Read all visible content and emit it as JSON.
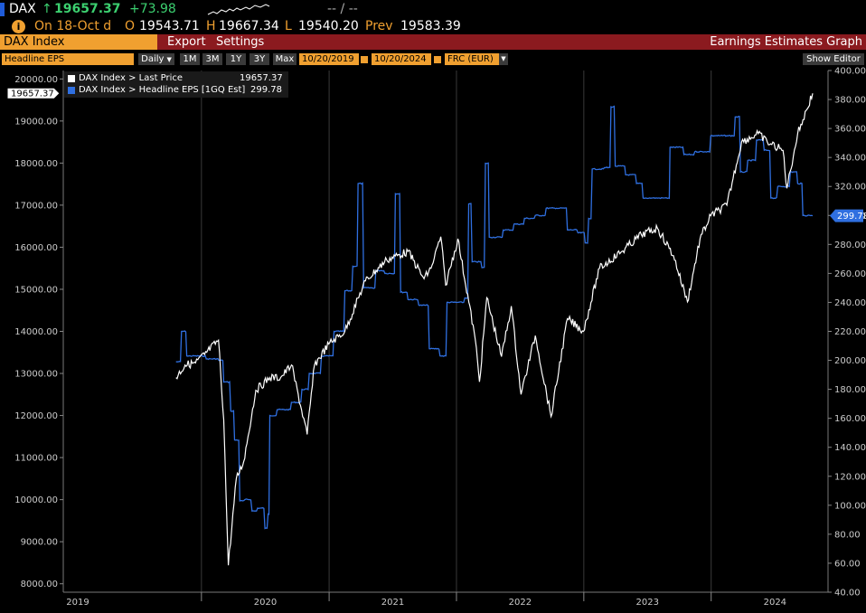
{
  "header": {
    "ticker": "DAX",
    "arrow": "↑",
    "last": "19657.37",
    "change": "+73.98",
    "dashes": "-- / --",
    "date_label": "On 18-Oct d",
    "open_label": "O",
    "open_value": "19543.71",
    "high_label": "H",
    "high_value": "19667.34",
    "low_label": "L",
    "low_value": "19540.20",
    "prev_label": "Prev",
    "prev_value": "19583.39"
  },
  "toolbar": {
    "security": "DAX Index",
    "export_label": "Export",
    "settings_label": "Settings",
    "function_title": "Earnings Estimates Graph"
  },
  "controls": {
    "field": "Headline EPS",
    "period": "Daily",
    "ranges": [
      "1M",
      "3M",
      "1Y",
      "3Y",
      "Max"
    ],
    "start_date": "10/20/2019",
    "end_date": "10/20/2024",
    "currency": "FRC (EUR)",
    "show_editor": "Show Editor"
  },
  "legend": [
    {
      "label": "DAX Index > Last Price",
      "value": "19657.37",
      "color": "#ffffff"
    },
    {
      "label": "DAX Index > Headline EPS [1GQ Est]",
      "value": "299.78",
      "color": "#2f6fe0"
    }
  ],
  "colors": {
    "accent_orange": "#f0a030",
    "toolbar_red": "#8b1a1f",
    "price_line": "#ffffff",
    "eps_line": "#2f6fe0"
  },
  "chart_data": {
    "type": "line",
    "x_labels": [
      "2019",
      "2020",
      "2021",
      "2022",
      "2023",
      "2024"
    ],
    "y_left": {
      "ticks": [
        "8000.00",
        "9000.00",
        "10000.00",
        "11000.00",
        "12000.00",
        "13000.00",
        "14000.00",
        "15000.00",
        "16000.00",
        "17000.00",
        "18000.00",
        "19000.00",
        "20000.00"
      ],
      "range": [
        7800,
        20200
      ]
    },
    "y_right": {
      "ticks": [
        "40.00",
        "60.00",
        "80.00",
        "100.00",
        "120.00",
        "140.00",
        "160.00",
        "180.00",
        "200.00",
        "220.00",
        "240.00",
        "260.00",
        "280.00",
        "300.00",
        "320.00",
        "340.00",
        "360.00",
        "380.00",
        "400.00"
      ],
      "range": [
        40,
        400
      ]
    },
    "last_price_tag": "19657.37",
    "eps_tag": "299.78",
    "series": [
      {
        "name": "DAX Index > Last Price",
        "axis": "left",
        "points": [
          [
            "2019-10-20",
            12900
          ],
          [
            "2019-11-15",
            13200
          ],
          [
            "2019-12-15",
            13250
          ],
          [
            "2020-01-10",
            13450
          ],
          [
            "2020-02-19",
            13790
          ],
          [
            "2020-03-05",
            11900
          ],
          [
            "2020-03-18",
            8440
          ],
          [
            "2020-04-10",
            10500
          ],
          [
            "2020-05-01",
            10900
          ],
          [
            "2020-06-05",
            12600
          ],
          [
            "2020-07-15",
            12900
          ],
          [
            "2020-08-15",
            12900
          ],
          [
            "2020-09-15",
            13200
          ],
          [
            "2020-10-30",
            11550
          ],
          [
            "2020-11-20",
            13200
          ],
          [
            "2020-12-31",
            13700
          ],
          [
            "2021-02-15",
            14000
          ],
          [
            "2021-04-15",
            15200
          ],
          [
            "2021-06-15",
            15700
          ],
          [
            "2021-08-15",
            15900
          ],
          [
            "2021-09-30",
            15250
          ],
          [
            "2021-10-20",
            15500
          ],
          [
            "2021-11-17",
            16250
          ],
          [
            "2021-12-01",
            15100
          ],
          [
            "2022-01-05",
            16200
          ],
          [
            "2022-02-24",
            13800
          ],
          [
            "2022-03-08",
            12800
          ],
          [
            "2022-03-29",
            14800
          ],
          [
            "2022-05-10",
            13400
          ],
          [
            "2022-06-07",
            14600
          ],
          [
            "2022-07-05",
            12500
          ],
          [
            "2022-08-15",
            13900
          ],
          [
            "2022-09-29",
            11975
          ],
          [
            "2022-11-15",
            14300
          ],
          [
            "2022-12-31",
            14000
          ],
          [
            "2023-02-15",
            15500
          ],
          [
            "2023-04-20",
            15900
          ],
          [
            "2023-06-15",
            16300
          ],
          [
            "2023-07-31",
            16450
          ],
          [
            "2023-09-15",
            15800
          ],
          [
            "2023-10-25",
            14700
          ],
          [
            "2023-11-30",
            16200
          ],
          [
            "2023-12-31",
            16750
          ],
          [
            "2024-02-15",
            17000
          ],
          [
            "2024-03-28",
            18500
          ],
          [
            "2024-05-15",
            18700
          ],
          [
            "2024-06-10",
            18500
          ],
          [
            "2024-07-25",
            18300
          ],
          [
            "2024-08-05",
            17400
          ],
          [
            "2024-09-05",
            18700
          ],
          [
            "2024-10-18",
            19657
          ]
        ]
      },
      {
        "name": "DAX Index > Headline EPS [1GQ Est]",
        "axis": "right",
        "points": [
          [
            "2019-10-20",
            199
          ],
          [
            "2019-11-05",
            220
          ],
          [
            "2019-11-20",
            203
          ],
          [
            "2020-01-15",
            201
          ],
          [
            "2020-02-20",
            200
          ],
          [
            "2020-03-05",
            185
          ],
          [
            "2020-03-25",
            165
          ],
          [
            "2020-04-05",
            145
          ],
          [
            "2020-04-20",
            103
          ],
          [
            "2020-05-05",
            104
          ],
          [
            "2020-05-25",
            96
          ],
          [
            "2020-06-10",
            98
          ],
          [
            "2020-07-01",
            84
          ],
          [
            "2020-07-10",
            94
          ],
          [
            "2020-07-15",
            162
          ],
          [
            "2020-08-05",
            166
          ],
          [
            "2020-09-15",
            171
          ],
          [
            "2020-10-15",
            180
          ],
          [
            "2020-11-05",
            191
          ],
          [
            "2020-12-10",
            203
          ],
          [
            "2021-01-15",
            220
          ],
          [
            "2021-02-15",
            248
          ],
          [
            "2021-03-10",
            265
          ],
          [
            "2021-03-25",
            322
          ],
          [
            "2021-04-10",
            250
          ],
          [
            "2021-05-15",
            262
          ],
          [
            "2021-06-10",
            260
          ],
          [
            "2021-07-10",
            315
          ],
          [
            "2021-07-25",
            247
          ],
          [
            "2021-08-15",
            242
          ],
          [
            "2021-09-15",
            238
          ],
          [
            "2021-10-15",
            208
          ],
          [
            "2021-11-15",
            203
          ],
          [
            "2021-12-05",
            240
          ],
          [
            "2022-01-05",
            240
          ],
          [
            "2022-01-25",
            243
          ],
          [
            "2022-02-05",
            308
          ],
          [
            "2022-02-15",
            268
          ],
          [
            "2022-03-15",
            264
          ],
          [
            "2022-03-25",
            336
          ],
          [
            "2022-04-05",
            285
          ],
          [
            "2022-05-15",
            290
          ],
          [
            "2022-06-15",
            294
          ],
          [
            "2022-07-15",
            298
          ],
          [
            "2022-08-15",
            300
          ],
          [
            "2022-09-15",
            305
          ],
          [
            "2022-10-15",
            305
          ],
          [
            "2022-11-15",
            290
          ],
          [
            "2022-12-15",
            288
          ],
          [
            "2023-01-05",
            281
          ],
          [
            "2023-01-15",
            298
          ],
          [
            "2023-01-25",
            332
          ],
          [
            "2023-03-01",
            333
          ],
          [
            "2023-03-20",
            375
          ],
          [
            "2023-04-01",
            334
          ],
          [
            "2023-05-01",
            328
          ],
          [
            "2023-06-01",
            322
          ],
          [
            "2023-06-20",
            312
          ],
          [
            "2023-07-15",
            312
          ],
          [
            "2023-08-15",
            312
          ],
          [
            "2023-09-01",
            312
          ],
          [
            "2023-09-05",
            347
          ],
          [
            "2023-10-15",
            342
          ],
          [
            "2023-11-15",
            344
          ],
          [
            "2023-12-15",
            344
          ],
          [
            "2023-12-31",
            355
          ],
          [
            "2024-02-15",
            355
          ],
          [
            "2024-03-10",
            368
          ],
          [
            "2024-03-25",
            330
          ],
          [
            "2024-04-15",
            338
          ],
          [
            "2024-05-10",
            352
          ],
          [
            "2024-06-01",
            345
          ],
          [
            "2024-06-20",
            312
          ],
          [
            "2024-07-10",
            320
          ],
          [
            "2024-08-15",
            330
          ],
          [
            "2024-09-05",
            322
          ],
          [
            "2024-09-20",
            300
          ],
          [
            "2024-10-18",
            299.78
          ]
        ]
      }
    ]
  }
}
